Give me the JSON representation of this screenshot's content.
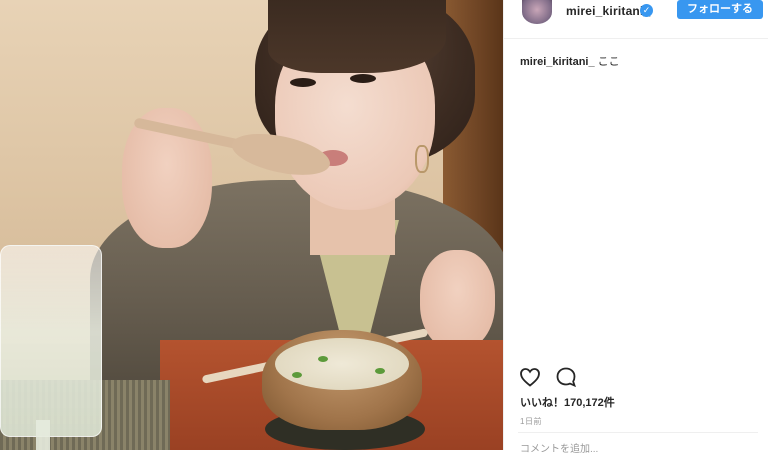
{
  "post": {
    "username": "mirei_kiritani_",
    "verified_mark": "✓",
    "follow_label": "フォローする",
    "caption_user": "mirei_kiritani_",
    "caption_text": "ここ",
    "likes": "いいね！170,172件",
    "time": "1日前",
    "comment_placeholder": "コメントを追加..."
  },
  "icons": {
    "heart": "heart-icon",
    "comment": "comment-icon"
  },
  "colors": {
    "accent": "#3897f0",
    "text": "#262626",
    "muted": "#999999"
  }
}
